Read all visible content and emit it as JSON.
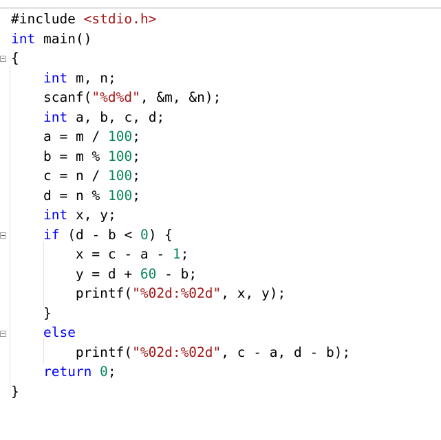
{
  "code_lines": [
    "#include <stdio.h>",
    "int main()",
    "{",
    "    int m, n;",
    "    scanf(\"%d%d\", &m, &n);",
    "    int a, b, c, d;",
    "    a = m / 100;",
    "    b = m % 100;",
    "    c = n / 100;",
    "    d = n % 100;",
    "    int x, y;",
    "    if (d - b < 0) {",
    "        x = c - a - 1;",
    "        y = d + 60 - b;",
    "        printf(\"%02d:%02d\", x, y);",
    "    }",
    "    else",
    "        printf(\"%02d:%02d\", c - a, d - b);",
    "    return 0;",
    "}"
  ],
  "colors": {
    "keyword": "#0000ff",
    "string": "#a31515",
    "number": "#098658",
    "text": "#000000"
  }
}
